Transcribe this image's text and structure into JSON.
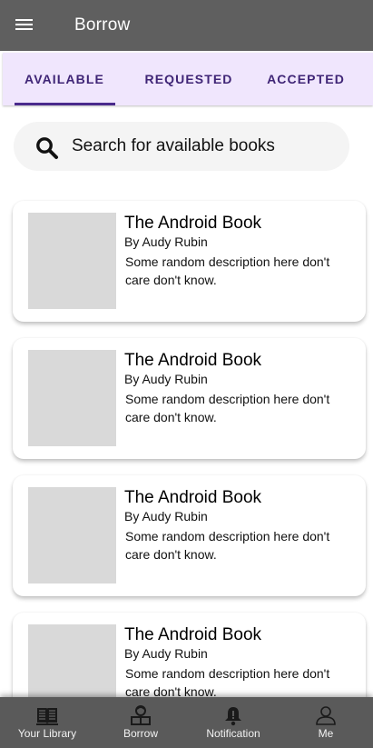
{
  "appbar": {
    "title": "Borrow",
    "menu_icon": "menu-icon"
  },
  "tabs": [
    {
      "label": "AVAILABLE",
      "selected": true
    },
    {
      "label": "REQUESTED",
      "selected": false
    },
    {
      "label": "ACCEPTED",
      "selected": false
    }
  ],
  "colors": {
    "appbar": "#5f5f5f",
    "tabs_bg": "#f0e6fd",
    "tab_text": "#3f2576",
    "bottom_nav": "#5a5a5a"
  },
  "search": {
    "placeholder": "Search for available books",
    "icon": "search-icon"
  },
  "books": [
    {
      "title": "The Android Book",
      "author": "By Audy Rubin",
      "description": "Some random description here don't care don't know."
    },
    {
      "title": "The Android Book",
      "author": "By Audy Rubin",
      "description": "Some random description here don't care don't know."
    },
    {
      "title": "The Android Book",
      "author": "By Audy Rubin",
      "description": "Some random description here don't care don't know."
    },
    {
      "title": "The Android Book",
      "author": "By Audy Rubin",
      "description": "Some random description here don't care don't know."
    }
  ],
  "bottom_nav": [
    {
      "label": "Your Library",
      "icon": "book-icon"
    },
    {
      "label": "Borrow",
      "icon": "reader-icon"
    },
    {
      "label": "Notification",
      "icon": "bell-icon"
    },
    {
      "label": "Me",
      "icon": "person-icon"
    }
  ]
}
